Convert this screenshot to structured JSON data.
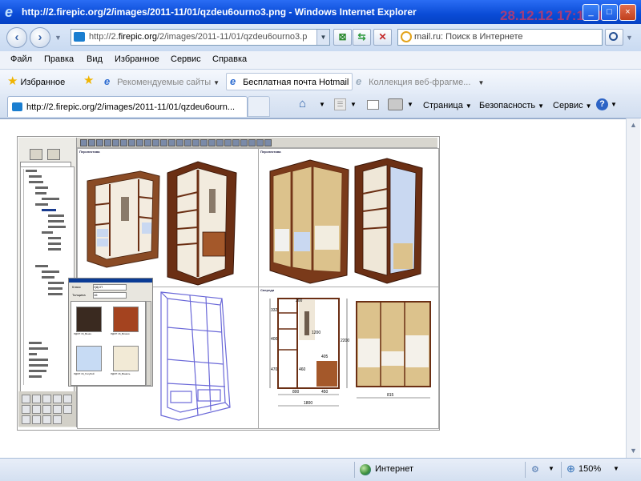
{
  "window": {
    "title": "http://2.firepic.org/2/images/2011-11/01/qzdeu6ourno3.png - Windows Internet Explorer",
    "stamp": "28.12.12 17:19:12",
    "controls": [
      "_",
      "□",
      "×"
    ]
  },
  "address_bar": {
    "url_prefix": "http://2.",
    "url_host": "firepic.org",
    "url_rest": "/2/images/2011-11/01/qzdeu6ourno3.p",
    "search_placeholder": "mail.ru: Поиск в Интернете"
  },
  "menu": [
    "Файл",
    "Правка",
    "Вид",
    "Избранное",
    "Сервис",
    "Справка"
  ],
  "favorites_bar": {
    "favorites_label": "Избранное",
    "recommended_label": "Рекомендуемые сайты",
    "hotmail_label": "Бесплатная почта Hotmail",
    "webslice_label": "Коллекция веб-фрагме..."
  },
  "tab": {
    "title": "http://2.firepic.org/2/images/2011-11/01/qzdeu6ourn..."
  },
  "command_bar": {
    "page_label": "Страница",
    "safety_label": "Безопасность",
    "tools_label": "Сервис"
  },
  "status_bar": {
    "zone_label": "Интернет",
    "zoom_label": "150%"
  },
  "image": {
    "tree_items": [
      "Шкаф",
      "Фасады",
      "Секции",
      "Карнизы",
      "Секция",
      "Горизонталь",
      "Секция",
      "Ящики",
      "Полки",
      "Штанга",
      "Секция",
      "Полки",
      "Дверцы",
      "Стенки задние",
      "Дно",
      "Стенки боковые",
      "Стенки верх",
      "Крышка"
    ],
    "pane_labels": [
      "Перспектива",
      "Перспектива",
      "Спереди"
    ],
    "subwindow": {
      "field1_label": "Класс",
      "field1_value": "ЛДСП",
      "field2_label": "Толщина",
      "field2_value": "16",
      "swatches": [
        {
          "label": "ЛДСП 16_Венге",
          "color": "#3a2a20"
        },
        {
          "label": "ЛДСП 16_Вишня",
          "color": "#a4431f"
        },
        {
          "label": "ЛДСП 16_Голубой",
          "color": "#c7dbf4"
        },
        {
          "label": "ЛДСП 16_Ваниль",
          "color": "#f2ead6"
        }
      ]
    },
    "dimensions": [
      "332",
      "200",
      "1200",
      "2200",
      "400",
      "470",
      "460",
      "405",
      "800",
      "450",
      "1800",
      "815"
    ],
    "colors": {
      "wood_dark": "#6b2f14",
      "wood_mid": "#8a4b25",
      "sand_panel": "#dcc28c",
      "mirror_blue": "#c9d8f1",
      "frame_purple": "#6a68d8"
    }
  }
}
